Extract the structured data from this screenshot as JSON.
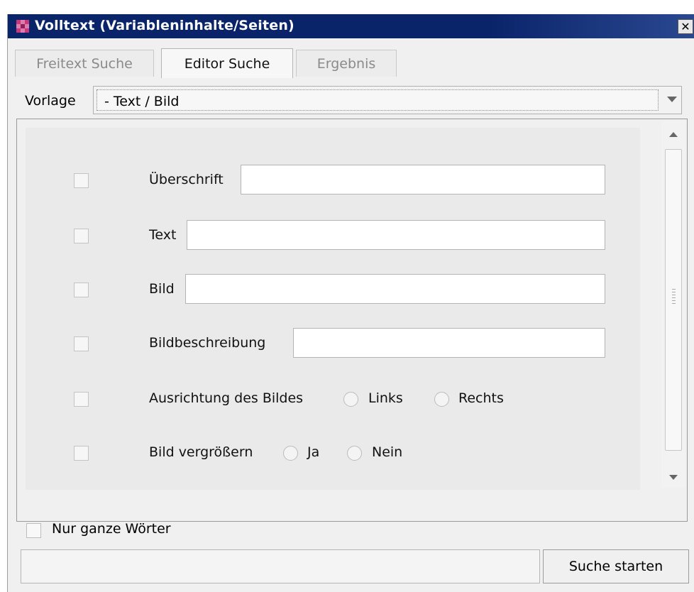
{
  "window": {
    "title": "Volltext (Variableninhalte/Seiten)",
    "close_glyph": "✕",
    "title_bar_color": "#0a246a"
  },
  "tabs": [
    {
      "label": "Freitext Suche",
      "active": false
    },
    {
      "label": "Editor Suche",
      "active": true
    },
    {
      "label": "Ergebnis",
      "active": false
    }
  ],
  "template": {
    "label": "Vorlage",
    "selected": "- Text / Bild"
  },
  "form": {
    "rows": [
      {
        "label": "Überschrift",
        "value": ""
      },
      {
        "label": "Text",
        "value": ""
      },
      {
        "label": "Bild",
        "value": ""
      },
      {
        "label": "Bildbeschreibung",
        "value": ""
      }
    ],
    "alignment": {
      "label": "Ausrichtung des Bildes",
      "options": [
        "Links",
        "Rechts"
      ]
    },
    "enlarge": {
      "label": "Bild vergrößern",
      "options": [
        "Ja",
        "Nein"
      ]
    }
  },
  "options": {
    "whole_words_label": "Nur ganze Wörter"
  },
  "actions": {
    "search_label": "Suche starten",
    "status_value": ""
  },
  "icons": {
    "app": "app-logo-icon",
    "close": "close-icon",
    "dropdown": "chevron-down-icon",
    "scroll_up": "scroll-up-arrow-icon",
    "scroll_down": "scroll-down-arrow-icon"
  }
}
